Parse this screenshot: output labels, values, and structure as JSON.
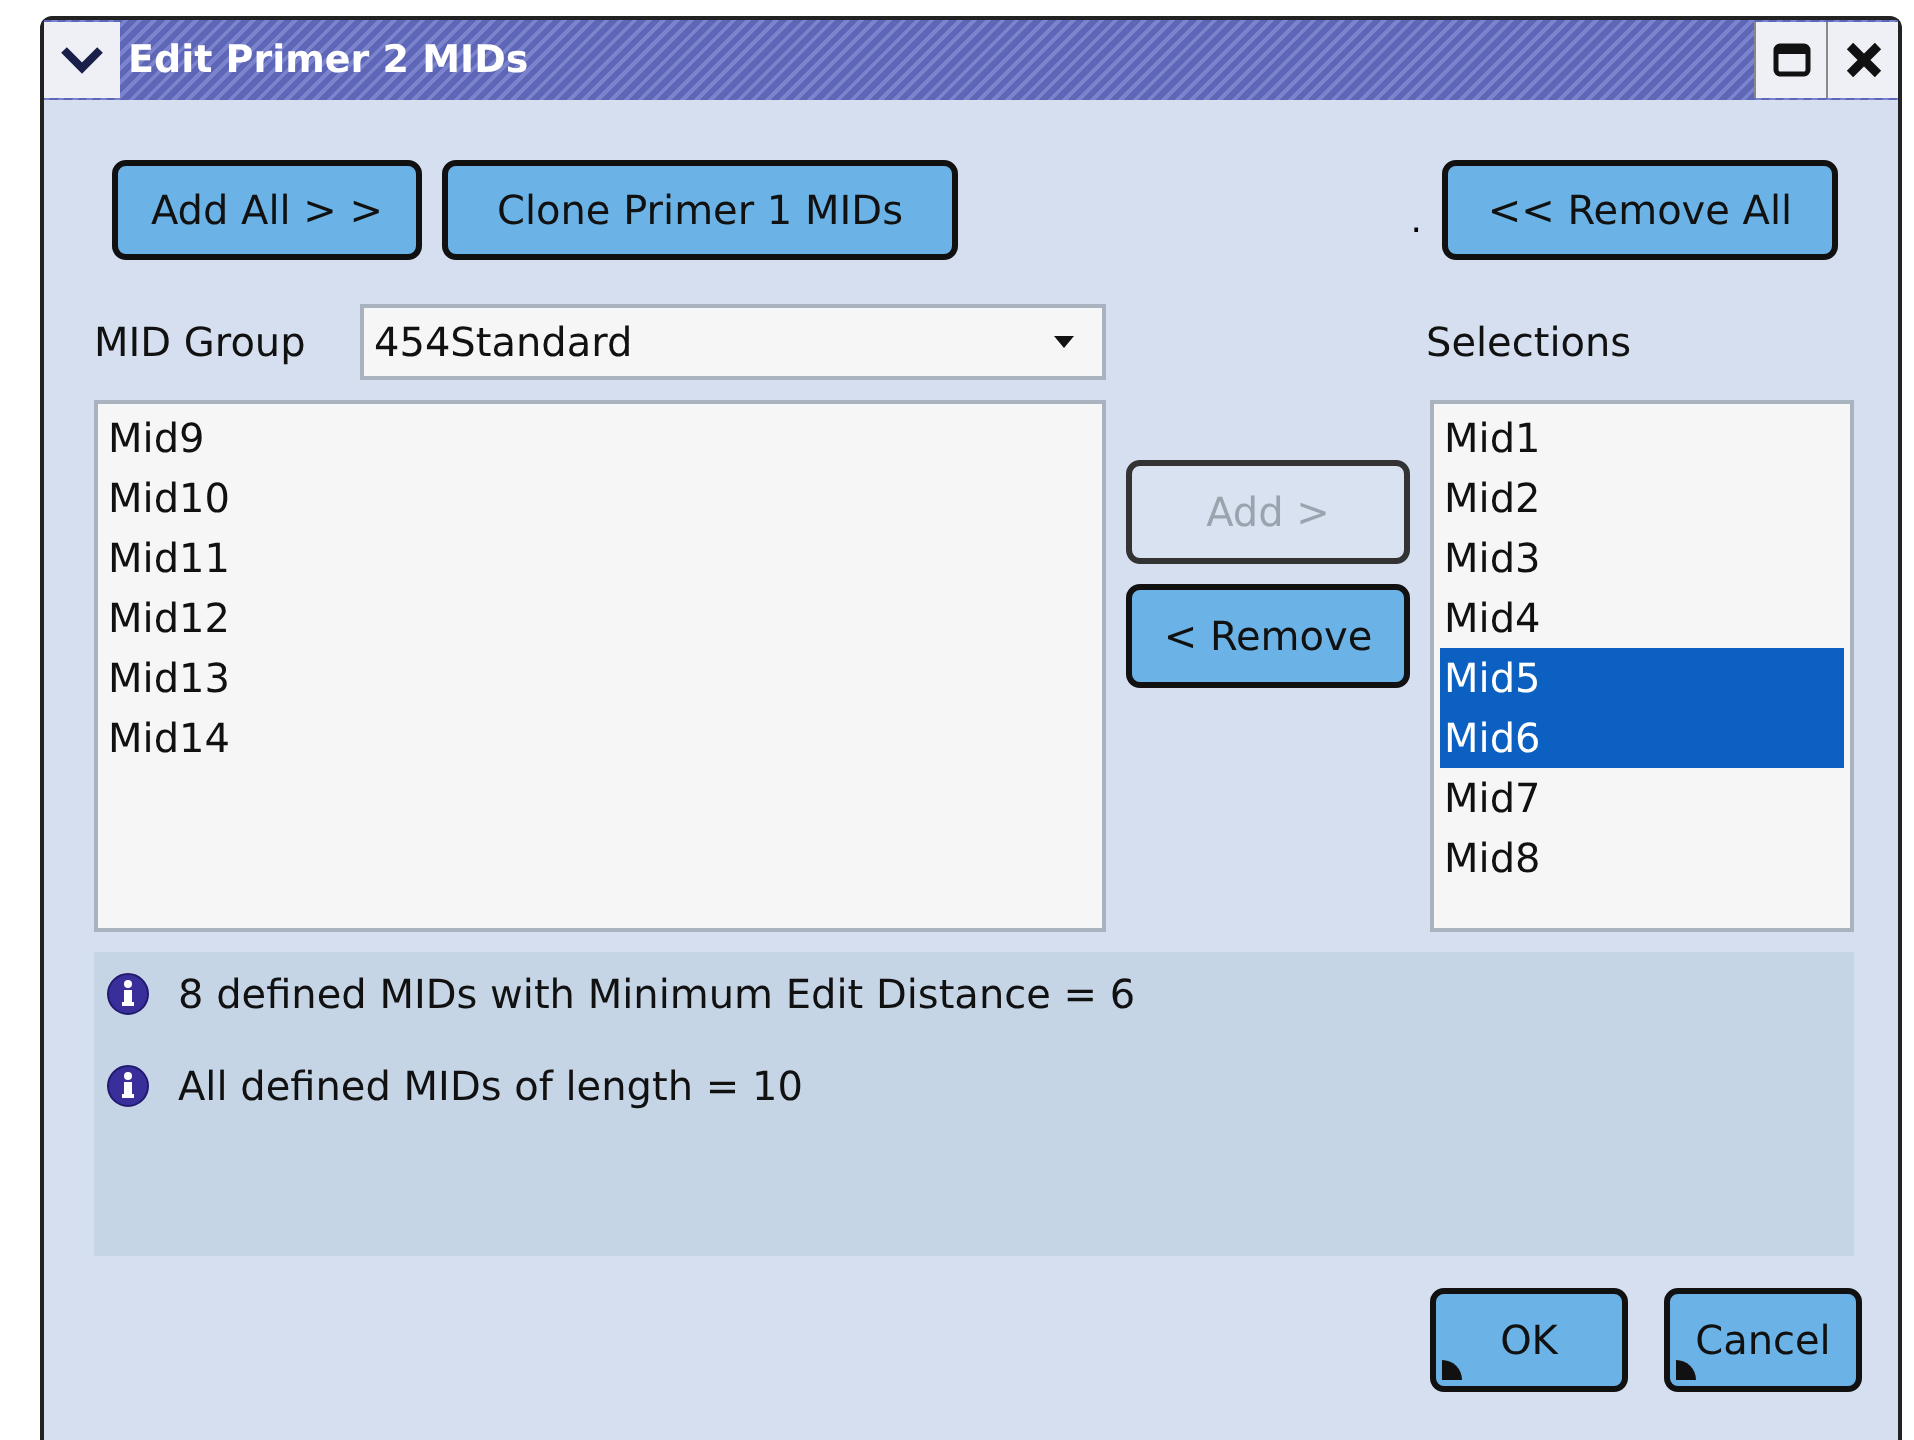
{
  "window": {
    "title": "Edit Primer 2 MIDs"
  },
  "top_buttons": [
    {
      "label": "Add All > >",
      "disabled": false
    },
    {
      "label": "Clone Primer 1 MIDs",
      "disabled": false
    }
  ],
  "separator_dot": ".",
  "remove_all_button": {
    "label": "<< Remove All",
    "disabled": false
  },
  "mid_group": {
    "label": "MID Group",
    "value": "454Standard"
  },
  "selections_label": "Selections",
  "available": [
    {
      "label": "Mid9",
      "selected": false
    },
    {
      "label": "Mid10",
      "selected": false
    },
    {
      "label": "Mid11",
      "selected": false
    },
    {
      "label": "Mid12",
      "selected": false
    },
    {
      "label": "Mid13",
      "selected": false
    },
    {
      "label": "Mid14",
      "selected": false
    }
  ],
  "move_buttons": [
    {
      "label": "Add >",
      "disabled": true
    },
    {
      "label": "< Remove",
      "disabled": false
    }
  ],
  "selections": [
    {
      "label": "Mid1",
      "selected": false
    },
    {
      "label": "Mid2",
      "selected": false
    },
    {
      "label": "Mid3",
      "selected": false
    },
    {
      "label": "Mid4",
      "selected": false
    },
    {
      "label": "Mid5",
      "selected": true
    },
    {
      "label": "Mid6",
      "selected": true
    },
    {
      "label": "Mid7",
      "selected": false
    },
    {
      "label": "Mid8",
      "selected": false
    }
  ],
  "messages": [
    "8 defined MIDs with Minimum Edit Distance = 6",
    "All defined MIDs of length = 10"
  ],
  "dialog_buttons": [
    {
      "label": "OK",
      "disabled": false
    },
    {
      "label": "Cancel",
      "disabled": false
    }
  ]
}
